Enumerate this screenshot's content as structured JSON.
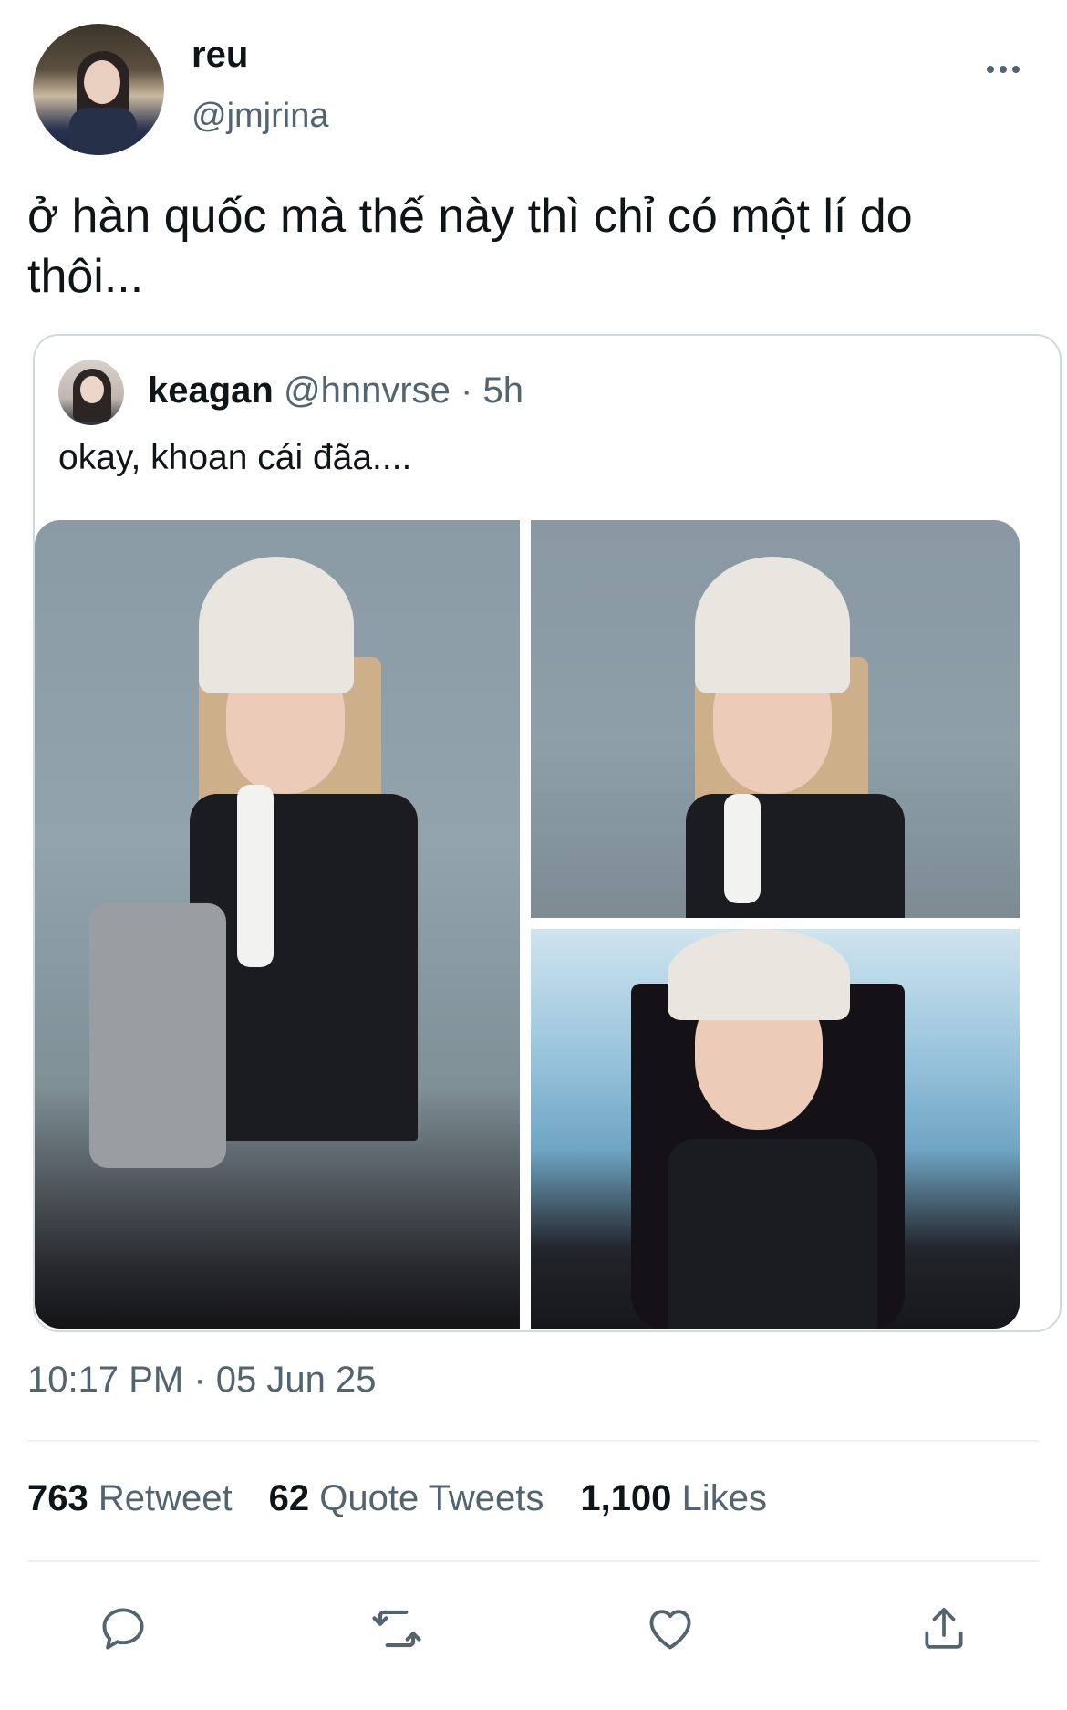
{
  "author": {
    "display_name": "reu",
    "username": "@jmjrina"
  },
  "tweet": {
    "text": "ở hàn quốc mà thế này thì chỉ có một lí do thôi...",
    "timestamp": "10:17 PM · 05 Jun 25"
  },
  "quote": {
    "display_name": "keagan",
    "meta": "@hnnvrse · 5h",
    "text": "okay, khoan cái đãa...."
  },
  "stats": {
    "retweets_count": "763",
    "retweets_label": "Retweet",
    "quotes_count": "62",
    "quotes_label": "Quote Tweets",
    "likes_count": "1,100",
    "likes_label": "Likes"
  },
  "icons": {
    "more": "more-horizontal-icon",
    "reply": "reply-icon",
    "retweet": "retweet-icon",
    "like": "heart-icon",
    "share": "share-icon"
  },
  "colors": {
    "text_primary": "#0f1419",
    "text_secondary": "#536471",
    "border": "#cfd9de",
    "divider": "#eff3f4"
  }
}
